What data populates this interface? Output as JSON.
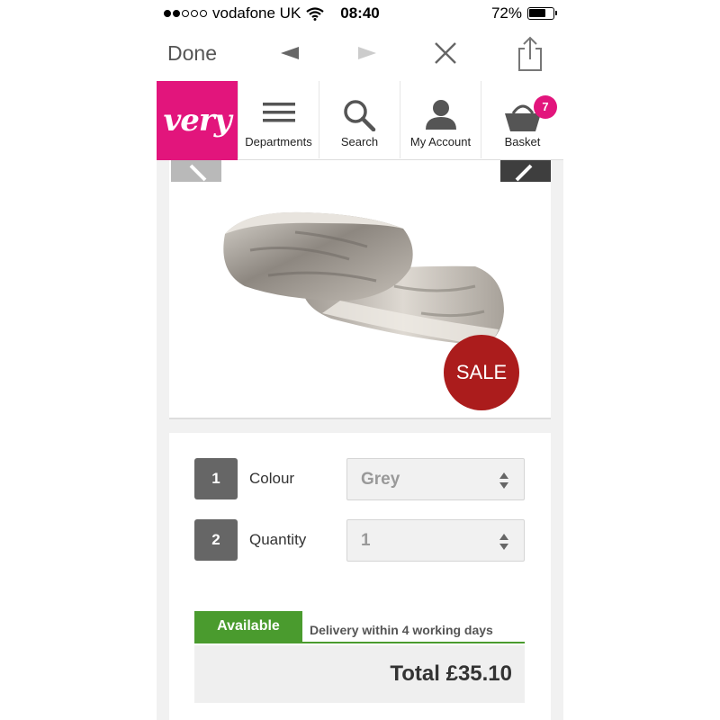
{
  "status_bar": {
    "carrier": "vodafone UK",
    "time": "08:40",
    "battery": "72%",
    "signal_bars_filled": 2,
    "signal_bars_total": 5
  },
  "browser": {
    "done_label": "Done",
    "icons": [
      "back-arrow-icon",
      "forward-arrow-icon",
      "close-icon",
      "share-icon"
    ]
  },
  "site": {
    "logo_text": "very",
    "brand_color": "#e2157c",
    "nav": [
      {
        "label": "Departments",
        "icon": "hamburger-menu-icon"
      },
      {
        "label": "Search",
        "icon": "search-icon"
      },
      {
        "label": "My Account",
        "icon": "user-icon"
      },
      {
        "label": "Basket",
        "icon": "basket-icon"
      }
    ],
    "basket_count": "7"
  },
  "product": {
    "sale_badge": "SALE",
    "sale_color": "#ab1c1c"
  },
  "options": {
    "colour": {
      "step": "1",
      "label": "Colour",
      "value": "Grey"
    },
    "quantity": {
      "step": "2",
      "label": "Quantity",
      "value": "1"
    }
  },
  "availability": {
    "status": "Available",
    "delivery": "Delivery within 4 working days",
    "status_color": "#4a9b2e"
  },
  "total": "Total £35.10"
}
